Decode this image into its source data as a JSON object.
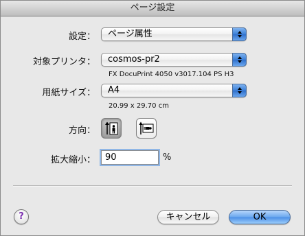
{
  "window": {
    "title": "ページ設定"
  },
  "settings": {
    "label": "設定：",
    "value": "ページ属性"
  },
  "printer": {
    "label": "対象プリンタ：",
    "value": "cosmos-pr2",
    "description": "FX DocuPrint 4050 v3017.104 PS H3"
  },
  "paper": {
    "label": "用紙サイズ：",
    "value": "A4",
    "dimensions": "20.99 x 29.70 cm"
  },
  "orientation": {
    "label": "方向：",
    "options": [
      {
        "icon": "portrait-orientation-icon",
        "selected": true
      },
      {
        "icon": "landscape-orientation-icon",
        "selected": false
      }
    ]
  },
  "scale": {
    "label": "拡大縮小：",
    "value": "90",
    "unit": "%"
  },
  "footer": {
    "help_label": "?",
    "cancel_label": "キャンセル",
    "ok_label": "OK"
  }
}
